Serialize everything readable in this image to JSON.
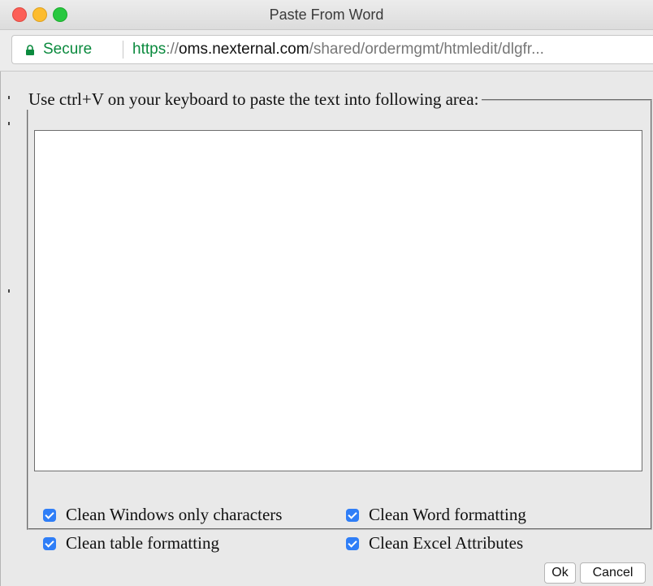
{
  "window": {
    "title": "Paste From Word"
  },
  "address_bar": {
    "secure_label": "Secure",
    "url_scheme": "https",
    "url_separator": "://",
    "url_host": "oms.nexternal.com",
    "url_path": "/shared/ordermgmt/htmledit/dlgfr..."
  },
  "dialog": {
    "instruction": "Use ctrl+V on your keyboard to paste the text into following area:",
    "paste_area_value": "",
    "options": [
      {
        "label": "Clean Windows only characters",
        "checked": true
      },
      {
        "label": "Clean Word formatting",
        "checked": true
      },
      {
        "label": "Clean table formatting",
        "checked": true
      },
      {
        "label": "Clean Excel Attributes",
        "checked": true
      }
    ],
    "ok_label": "Ok",
    "cancel_label": "Cancel"
  },
  "colors": {
    "secure_green": "#0b8a3e",
    "checkbox_blue": "#2f7ef7",
    "close": "#fc5f57",
    "minimize": "#fdbc2e",
    "maximize": "#28c840"
  },
  "icons": [
    "close-window-icon",
    "minimize-window-icon",
    "maximize-window-icon",
    "lock-icon",
    "checkmark-icon"
  ]
}
